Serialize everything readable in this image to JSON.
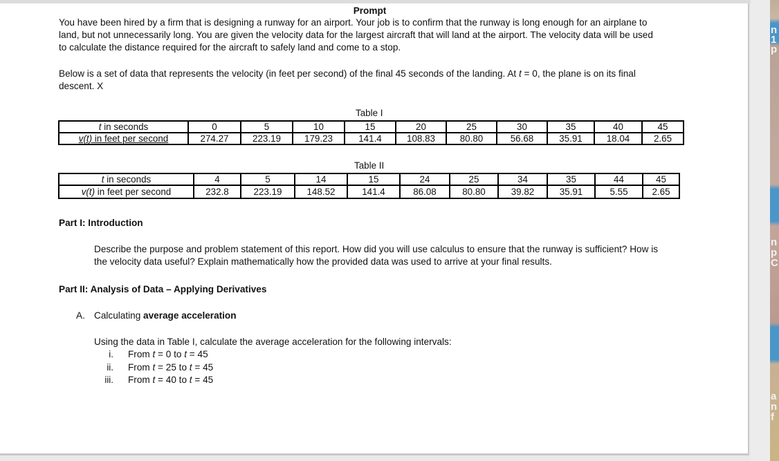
{
  "document": {
    "heading": "Prompt",
    "intro_lines": [
      "You have been hired by a firm that is designing a runway for an airport. Your job is to confirm that the runway is long enough for an airplane to",
      "land, but not unnecessarily long. You are given the velocity data for the largest aircraft that will land at the airport. The velocity data will be used",
      "to calculate the distance required for the aircraft to safely land and come to a stop."
    ],
    "data_intro_line1_pre": "Below is a set of data that represents the velocity (in feet per second) of the final 45 seconds of the landing. At ",
    "data_intro_var": "t",
    "data_intro_line1_post": " = 0, the plane is on its final",
    "data_intro_line2": "descent. X",
    "tables": [
      {
        "caption": "Table I",
        "row_labels": [
          {
            "var": "t",
            "rest": " in seconds"
          },
          {
            "var": "v(t)",
            "rest": " in feet per second"
          }
        ],
        "t": [
          "0",
          "5",
          "10",
          "15",
          "20",
          "25",
          "30",
          "35",
          "40",
          "45"
        ],
        "v": [
          "274.27",
          "223.19",
          "179.23",
          "141.4",
          "108.83",
          "80.80",
          "56.68",
          "35.91",
          "18.04",
          "2.65"
        ]
      },
      {
        "caption": "Table II",
        "row_labels": [
          {
            "var": "t",
            "rest": " in seconds"
          },
          {
            "var": "v(t)",
            "rest": " in feet per second"
          }
        ],
        "t": [
          "4",
          "5",
          "14",
          "15",
          "24",
          "25",
          "34",
          "35",
          "44",
          "45"
        ],
        "v": [
          "232.8",
          "223.19",
          "148.52",
          "141.4",
          "86.08",
          "80.80",
          "39.82",
          "35.91",
          "5.55",
          "2.65"
        ]
      }
    ],
    "part1": {
      "title": "Part I: Introduction",
      "lines": [
        "Describe the purpose and problem statement of this report. How did you will use calculus to ensure that the runway is sufficient? How is",
        "the velocity data useful? Explain mathematically how the provided data was used to arrive at your final results."
      ]
    },
    "part2": {
      "title": "Part II: Analysis of Data – Applying Derivatives",
      "section_a": {
        "marker": "A.",
        "label_plain": "Calculating ",
        "label_bold": "average acceleration",
        "instruction": "Using the data in Table I, calculate the average acceleration for the following intervals:",
        "items": [
          {
            "num": "i.",
            "from": "0",
            "to": "45"
          },
          {
            "num": "ii.",
            "from": "25",
            "to": "45"
          },
          {
            "num": "iii.",
            "from": "40",
            "to": "45"
          }
        ],
        "item_from_word": "From ",
        "item_to_word": " to ",
        "var": "t",
        "eq": " = "
      }
    }
  },
  "side_peek": {
    "glyphs": [
      "n",
      "1",
      "p",
      "n",
      "p",
      "C",
      "a",
      "n",
      "f"
    ]
  }
}
